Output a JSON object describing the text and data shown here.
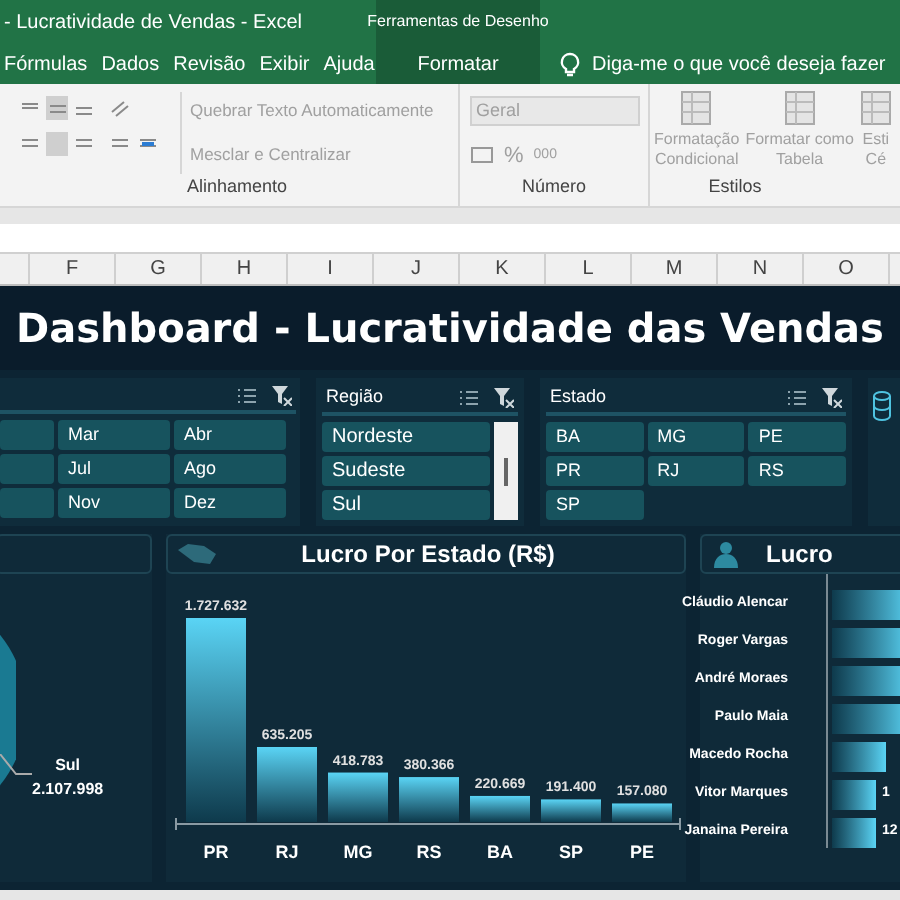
{
  "window": {
    "title": "- Lucratividade de Vendas  -  Excel",
    "context_group": "Ferramentas de Desenho"
  },
  "ribbon_tabs": [
    {
      "label": "Fórmulas"
    },
    {
      "label": "Dados"
    },
    {
      "label": "Revisão"
    },
    {
      "label": "Exibir"
    },
    {
      "label": "Ajuda"
    }
  ],
  "context_tab": {
    "label": "Formatar"
  },
  "tell_me": "Diga-me o que você deseja fazer",
  "ribbon": {
    "alignment": {
      "label": "Alinhamento",
      "wrap_text": "Quebrar Texto Automaticamente",
      "merge": "Mesclar e Centralizar"
    },
    "number": {
      "label": "Número",
      "format": "Geral",
      "percent": "%",
      "thousands": "000"
    },
    "styles": {
      "label": "Estilos",
      "conditional": [
        "Formatação",
        "Condicional"
      ],
      "table": [
        "Formatar como",
        "Tabela"
      ],
      "cell": [
        "Esti",
        "Cé"
      ]
    }
  },
  "columns": [
    "F",
    "G",
    "H",
    "I",
    "J",
    "K",
    "L",
    "M",
    "N",
    "O"
  ],
  "dashboard": {
    "title": "Dashboard - Lucratividade das Vendas",
    "month_slicer": {
      "items": [
        {
          "selected": true
        },
        {
          "label": "Mar",
          "selected": true
        },
        {
          "label": "Abr",
          "selected": true
        },
        {
          "selected": true
        },
        {
          "label": "Jul",
          "selected": true
        },
        {
          "label": "Ago",
          "selected": true
        },
        {
          "selected": true
        },
        {
          "label": "Nov",
          "selected": true
        },
        {
          "label": "Dez",
          "selected": true
        }
      ]
    },
    "region_slicer": {
      "title": "Região",
      "items": [
        {
          "label": "Nordeste",
          "selected": true
        },
        {
          "label": "Sudeste",
          "selected": true
        },
        {
          "label": "Sul",
          "selected": true
        }
      ]
    },
    "state_slicer": {
      "title": "Estado",
      "items": [
        {
          "label": "BA",
          "selected": true
        },
        {
          "label": "MG",
          "selected": true
        },
        {
          "label": "PE",
          "selected": true
        },
        {
          "label": "PR",
          "selected": true
        },
        {
          "label": "RJ",
          "selected": true
        },
        {
          "label": "RS",
          "selected": true
        },
        {
          "label": "SP",
          "selected": true
        }
      ]
    },
    "pie_panel": {
      "label": "Sul",
      "value": "2.107.998"
    },
    "state_chart": {
      "title": "Lucro Por Estado (R$)",
      "chart_data": {
        "type": "bar",
        "categories": [
          "PR",
          "RJ",
          "MG",
          "RS",
          "BA",
          "SP",
          "PE"
        ],
        "values": [
          1727632,
          635205,
          418783,
          380366,
          220669,
          191400,
          157080
        ],
        "value_labels": [
          "1.727.632",
          "635.205",
          "418.783",
          "380.366",
          "220.669",
          "191.400",
          "157.080"
        ]
      }
    },
    "seller_chart": {
      "title": "Lucro",
      "sellers": [
        {
          "name": "Cláudio Alencar"
        },
        {
          "name": "Roger Vargas"
        },
        {
          "name": "André Moraes"
        },
        {
          "name": "Paulo Maia"
        },
        {
          "name": "Macedo Rocha"
        },
        {
          "name": "Vitor Marques",
          "value": "1"
        },
        {
          "name": "Janaina Pereira",
          "value": "12"
        }
      ]
    }
  }
}
